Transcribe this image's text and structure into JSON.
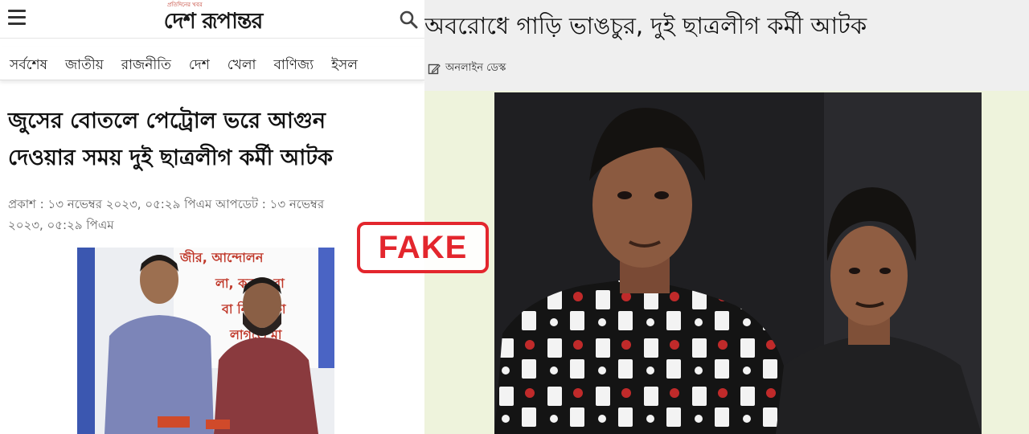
{
  "left_site": {
    "brand_tagline": "প্রতিদিনের খবর",
    "brand_name": "দেশ রূপান্তর",
    "nav_items": [
      "সর্বশেষ",
      "জাতীয়",
      "রাজনীতি",
      "দেশ",
      "খেলা",
      "বাণিজ্য",
      "ইসল"
    ],
    "headline_line1": "জুসের বোতলে পেট্রোল ভরে আগুন",
    "headline_line2": "দেওয়ার সময় দুই ছাত্রলীগ কর্মী আটক",
    "meta_line1": "প্রকাশ : ১৩ নভেম্বর ২০২৩, ০৫:২৯ পিএম আপডেট : ১৩ নভেম্বর",
    "meta_line2": "২০২৩, ০৫:২৯ পিএম",
    "photo_banner_lines": [
      "জীর, আন্দোলন",
      "লা, করতে বা",
      "বা নিতে কো",
      "লাগতে মা"
    ]
  },
  "right_site": {
    "headline": "অবরোধে গাড়ি ভাঙচুর, দুই ছাত্রলীগ কর্মী আটক",
    "byline": "অনলাইন ডেস্ক"
  },
  "stamp": {
    "label": "FAKE",
    "color": "#e3262d"
  },
  "colors": {
    "right_bg": "#eef3dc",
    "header_bg": "#efefef"
  }
}
